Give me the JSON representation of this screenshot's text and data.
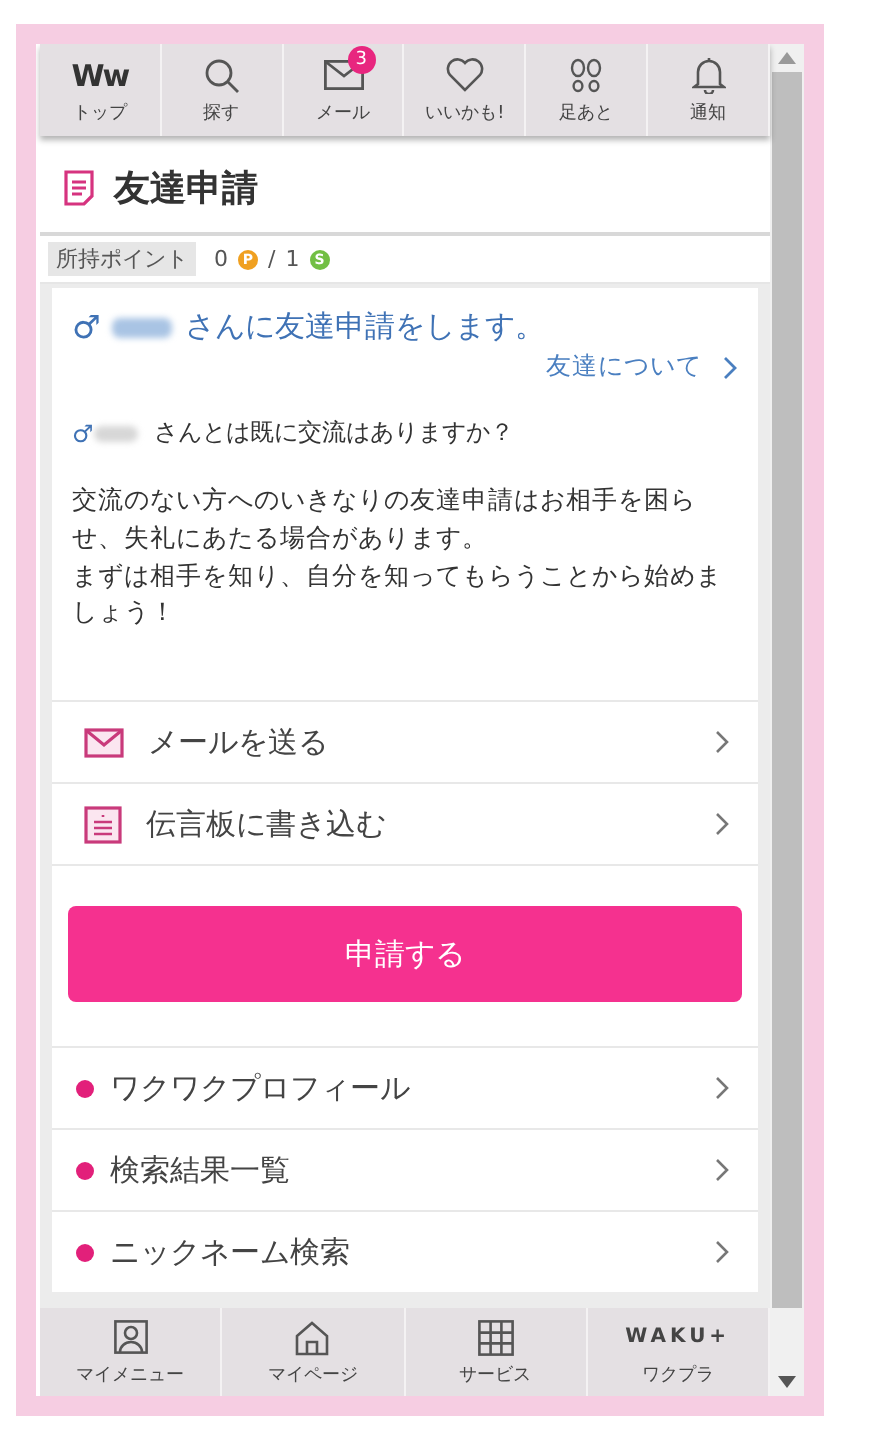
{
  "top_nav": [
    {
      "kind": "logo",
      "logo": "Ww",
      "label": "トップ"
    },
    {
      "kind": "search",
      "label": "探す"
    },
    {
      "kind": "mail",
      "label": "メール",
      "badge": "3"
    },
    {
      "kind": "heart",
      "label": "いいかも!"
    },
    {
      "kind": "footprints",
      "label": "足あと"
    },
    {
      "kind": "bell",
      "label": "通知"
    }
  ],
  "page_title": "友達申請",
  "points": {
    "label": "所持ポイント",
    "coins": [
      {
        "value": "0",
        "symbol": "P",
        "color": "#f0a020"
      },
      {
        "value": "1",
        "symbol": "S",
        "color": "#72bf44"
      }
    ],
    "separator": "/"
  },
  "request": {
    "gender": "♂",
    "text": "さんに友達申請をします。",
    "link": "友達について"
  },
  "question": {
    "gender": "♂",
    "text": "さんとは既に交流はありますか？"
  },
  "notice": [
    "交流のない方へのいきなりの友達申請はお相手を困らせ、失礼にあたる場合があります。",
    "まずは相手を知り、自分を知ってもらうことから始めましょう！"
  ],
  "actions": [
    {
      "kind": "mail",
      "label": "メールを送る"
    },
    {
      "kind": "board",
      "label": "伝言板に書き込む"
    }
  ],
  "submit_button": "申請する",
  "links": [
    "ワクワクプロフィール",
    "検索結果一覧",
    "ニックネーム検索"
  ],
  "bottom_nav": [
    {
      "kind": "person",
      "label": "マイメニュー"
    },
    {
      "kind": "home",
      "label": "マイページ"
    },
    {
      "kind": "grid",
      "label": "サービス"
    },
    {
      "kind": "logo",
      "logo": "WAKU+",
      "label": "ワクプラ"
    }
  ]
}
